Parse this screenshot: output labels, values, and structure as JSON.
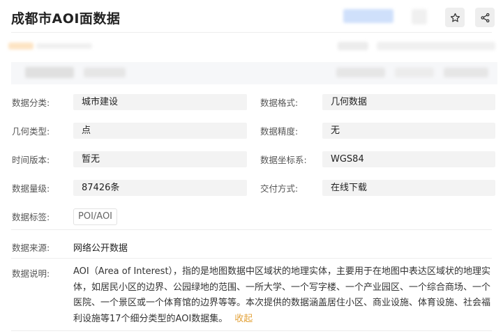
{
  "header": {
    "title": "成都市AOI面数据",
    "star_icon": "star-icon",
    "share_icon": "share-icon"
  },
  "fields": {
    "category": {
      "label": "数据分类:",
      "value": "城市建设"
    },
    "format": {
      "label": "数据格式:",
      "value": "几何数据"
    },
    "geometry": {
      "label": "几何类型:",
      "value": "点"
    },
    "precision": {
      "label": "数据精度:",
      "value": "无"
    },
    "version": {
      "label": "时间版本:",
      "value": "暂无"
    },
    "crs": {
      "label": "数据坐标系:",
      "value": "WGS84"
    },
    "volume": {
      "label": "数据量级:",
      "value": "87426条"
    },
    "delivery": {
      "label": "交付方式:",
      "value": "在线下载"
    },
    "tags": {
      "label": "数据标签:",
      "values": [
        "POI/AOI"
      ]
    },
    "source": {
      "label": "数据来源:",
      "value": "网络公开数据"
    },
    "description": {
      "label": "数据说明:",
      "text": "AOI（Area of Interest），指的是地图数据中区域状的地理实体，主要用于在地图中表达区域状的地理实体，如居民小区的边界、公园绿地的范围、一所大学、一个写字楼、一个产业园区、一个综合商场、一个医院、一个景区或一个体育馆的边界等等。本次提供的数据涵盖居住小区、商业设施、体育设施、社会福利设施等17个细分类型的AOI数据集。",
      "collapse_label": "收起"
    }
  },
  "colors": {
    "accent": "#e3a238",
    "value_bg": "#f3f3f3",
    "strip_bg": "#f6f7f9"
  }
}
